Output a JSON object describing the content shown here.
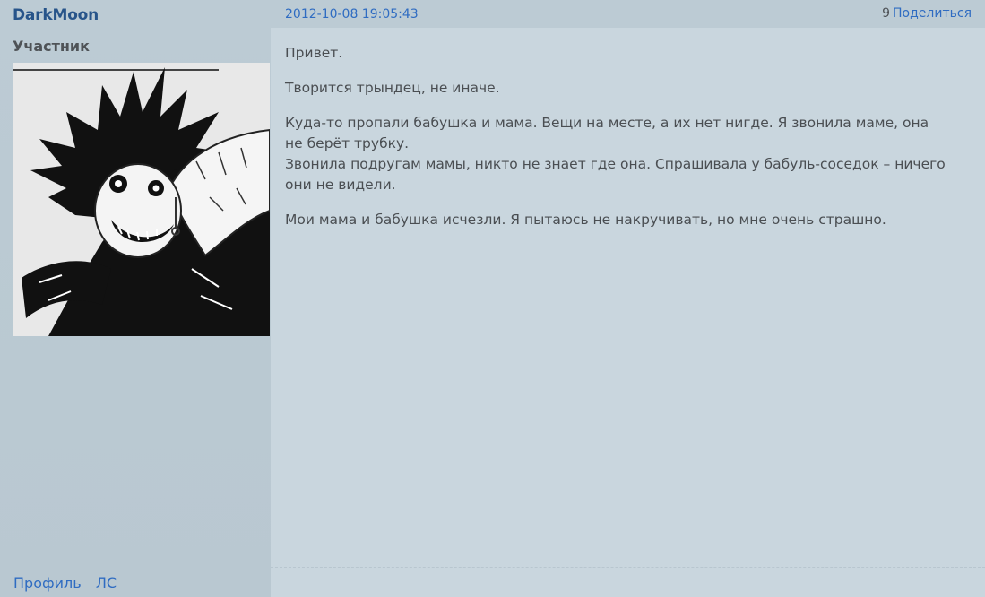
{
  "author": {
    "name": "DarkMoon",
    "title": "Участник",
    "links": {
      "profile": "Профиль",
      "pm": "ЛС"
    }
  },
  "post": {
    "timestamp": "2012-10-08 19:05:43",
    "number": "9",
    "share_label": "Поделиться",
    "paragraphs": [
      "Привет.",
      "Творится трындец, не иначе.",
      "Куда-то пропали бабушка и мама. Вещи на месте, а их нет нигде. Я звонила маме, она не берёт трубку.",
      "Звонила подругам мамы, никто не знает где она. Спрашивала у бабуль-соседок – ничего они не видели.",
      "Мои мама и бабушка исчезли. Я пытаюсь не накручивать, но мне очень страшно."
    ]
  },
  "colors": {
    "link": "#2f6cc2",
    "username": "#27548a",
    "sidebar_bg": "#bccbd4",
    "body_bg": "#c9d6de",
    "text": "#4a4e52"
  }
}
